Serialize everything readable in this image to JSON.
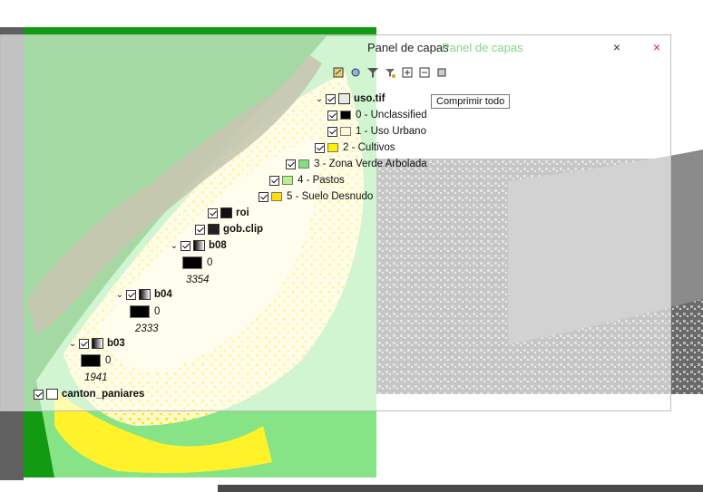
{
  "panel": {
    "title": "Panel de capas",
    "title_ghost": "Panel de capas",
    "tooltip": "Comprimir todo",
    "close_label": "×",
    "ghost_close_label": "×"
  },
  "toolbar": {
    "icons": [
      "open-layer-styling-icon",
      "add-group-icon",
      "filter-map-icon",
      "filter-legend-icon",
      "expand-all-icon",
      "collapse-all-icon",
      "remove-layer-icon"
    ]
  },
  "layers": {
    "uso": {
      "name": "uso.tif",
      "classes": [
        {
          "label": "0 - Unclassified",
          "color": "#000000"
        },
        {
          "label": "1 - Uso Urbano",
          "color": "#fff8d6"
        },
        {
          "label": "2 - Cultivos",
          "color": "#fff000"
        },
        {
          "label": "3 - Zona Verde Arbolada",
          "color": "#7fe07f"
        },
        {
          "label": "4 - Pastos",
          "color": "#b8f08a"
        },
        {
          "label": "5 - Suelo Desnudo",
          "color": "#ffe000"
        }
      ]
    },
    "roi": {
      "name": "roi"
    },
    "gob": {
      "name": "gob.clip"
    },
    "b08": {
      "name": "b08",
      "min": "0",
      "max": "3354"
    },
    "b04": {
      "name": "b04",
      "min": "0",
      "max": "2333"
    },
    "b03": {
      "name": "b03",
      "min": "0",
      "max": "1941"
    },
    "canton": {
      "name": "canton_paniares"
    }
  },
  "colors": {
    "forest": "#129b12",
    "light_green": "#86e486",
    "cream": "#fffbd2",
    "yellow": "#fff22a",
    "olive": "#6d6a31",
    "gray_dark": "#5f5f5f",
    "gray_light": "#a8a8a8"
  }
}
